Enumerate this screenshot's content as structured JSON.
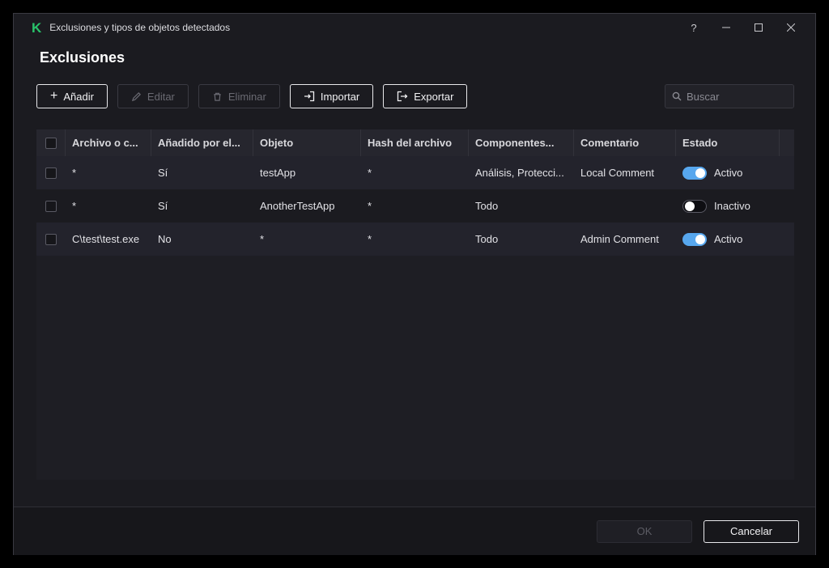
{
  "window": {
    "title": "Exclusiones y tipos de objetos detectados",
    "help_label": "?"
  },
  "page": {
    "title": "Exclusiones"
  },
  "toolbar": {
    "add": "Añadir",
    "edit": "Editar",
    "delete": "Eliminar",
    "import": "Importar",
    "export": "Exportar",
    "search_placeholder": "Buscar"
  },
  "table": {
    "columns": [
      "Archivo o c...",
      "Añadido por el...",
      "Objeto",
      "Hash del archivo",
      "Componentes...",
      "Comentario",
      "Estado"
    ],
    "rows": [
      {
        "file": "*",
        "added_by": "Sí",
        "object": "testApp",
        "hash": "*",
        "components": "Análisis, Protecci...",
        "comment": "Local Comment",
        "state": "Activo",
        "active": true
      },
      {
        "file": "*",
        "added_by": "Sí",
        "object": "AnotherTestApp",
        "hash": "*",
        "components": "Todo",
        "comment": "",
        "state": "Inactivo",
        "active": false
      },
      {
        "file": "C\\test\\test.exe",
        "added_by": "No",
        "object": "*",
        "hash": "*",
        "components": "Todo",
        "comment": "Admin Comment",
        "state": "Activo",
        "active": true
      }
    ]
  },
  "footer": {
    "ok": "OK",
    "cancel": "Cancelar"
  },
  "colors": {
    "brand_green": "#29c36a",
    "toggle_on_blue": "#57a7ee",
    "window_bg": "#1b1b20"
  }
}
